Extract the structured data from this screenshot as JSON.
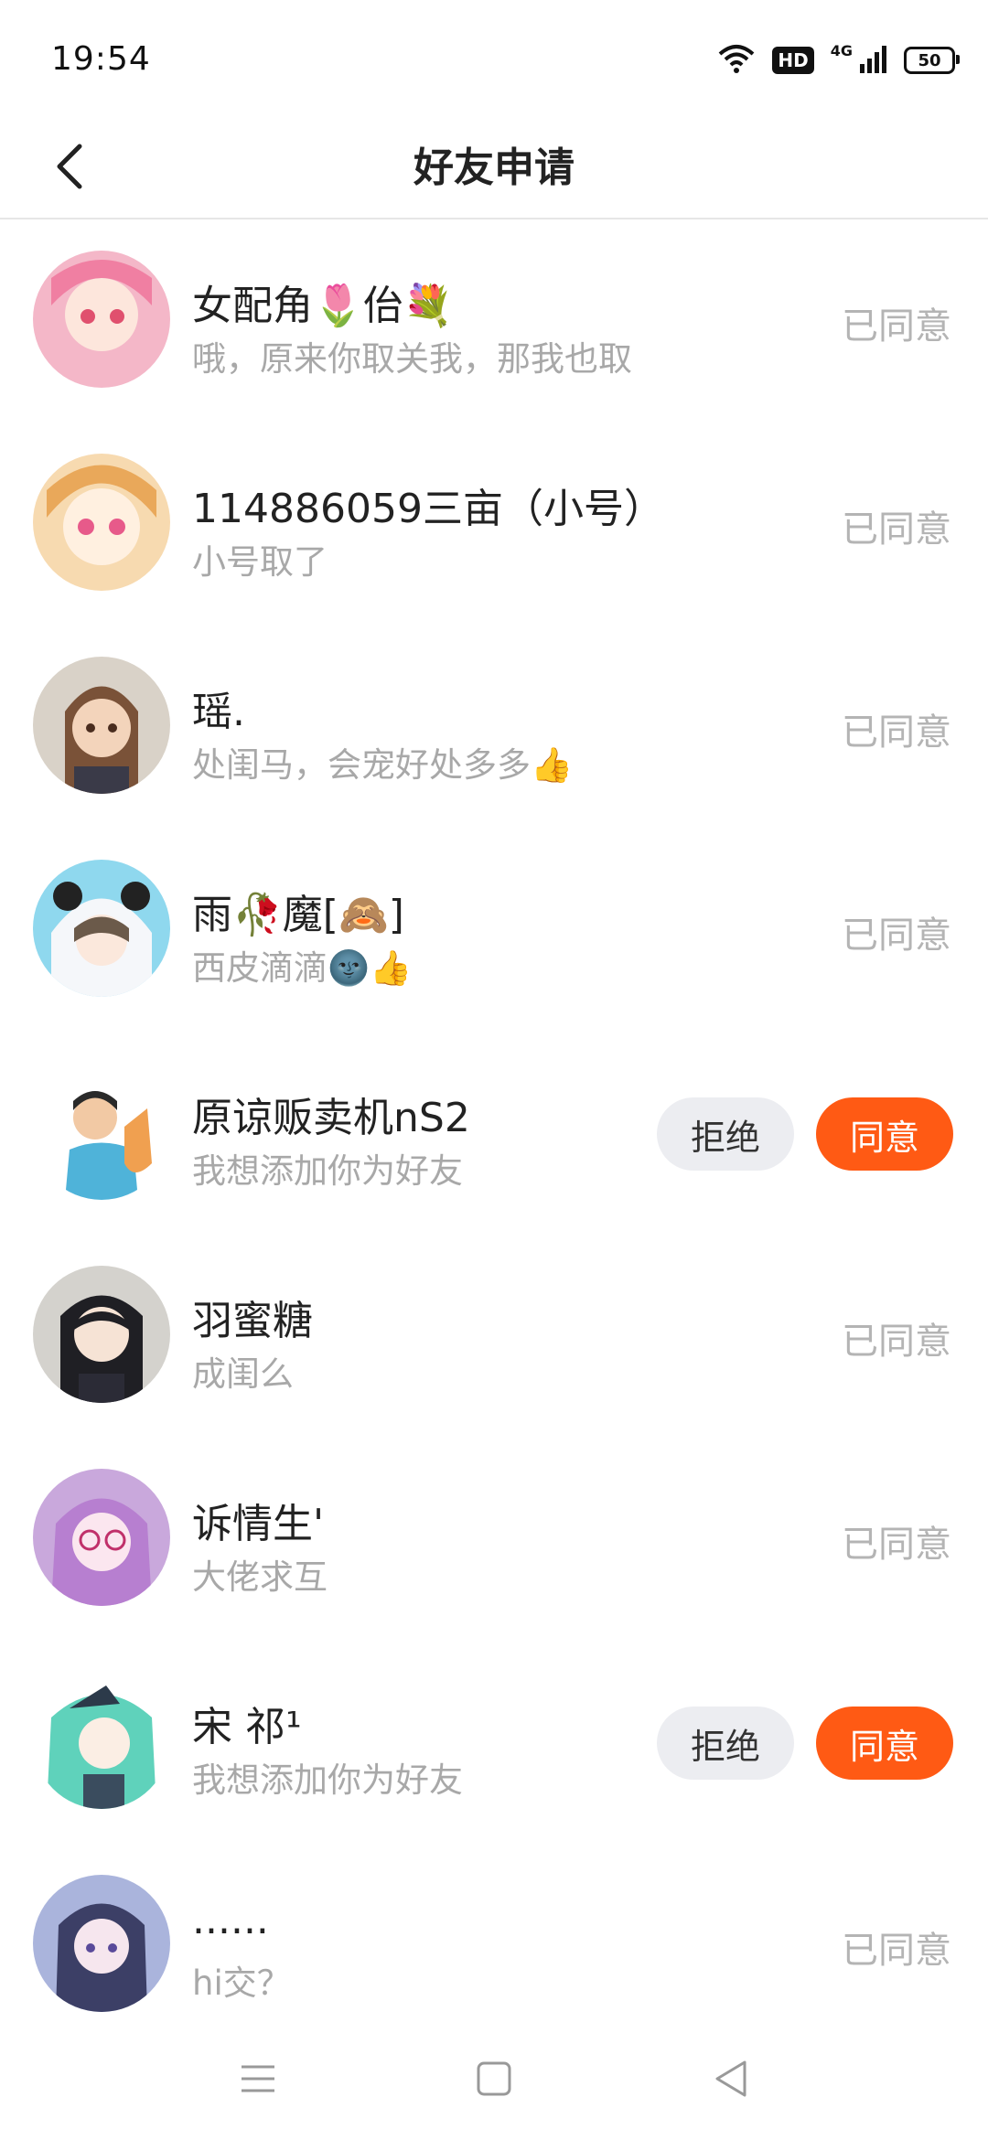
{
  "status_bar": {
    "time": "19:54",
    "hd": "HD",
    "network": "4G",
    "battery": "50"
  },
  "header": {
    "title": "好友申请",
    "back_icon": "chevron-left-icon"
  },
  "requests": [
    {
      "name": "女配角🌷佁💐",
      "message": "哦，原来你取关我，那我也取",
      "status": "已同意",
      "avatar_color": "#f4b7c8"
    },
    {
      "name": "114886059三亩（小号）",
      "message": "小号取了",
      "status": "已同意",
      "avatar_color": "#f3c98f"
    },
    {
      "name": "瑶.",
      "message": "处闺马，会宠好处多多👍",
      "status": "已同意",
      "avatar_color": "#cdbfae"
    },
    {
      "name": "雨🥀魔[🙈]",
      "message": "西皮滴滴🌚👍",
      "status": "已同意",
      "avatar_color": "#7fcfe6"
    },
    {
      "name": "原谅贩卖机nS2",
      "message": "我想添加你为好友",
      "reject_label": "拒绝",
      "agree_label": "同意",
      "avatar_color": "#6bb8d8"
    },
    {
      "name": "羽蜜糖",
      "message": "成闺么",
      "status": "已同意",
      "avatar_color": "#b9b6b0"
    },
    {
      "name": "诉情生'",
      "message": "大佬求互",
      "status": "已同意",
      "avatar_color": "#c7a3d8"
    },
    {
      "name": "宋  祁¹",
      "message": "我想添加你为好友",
      "reject_label": "拒绝",
      "agree_label": "同意",
      "avatar_color": "#6fd4c2"
    },
    {
      "name": "......",
      "message": "hi交？",
      "status": "已同意",
      "avatar_color": "#9aa6d4"
    }
  ],
  "colors": {
    "accent": "#ff5a14",
    "reject_bg": "#ecedf1",
    "muted_text": "#a8a8a8"
  },
  "nav": {
    "menu_icon": "menu-icon",
    "home_icon": "square-home-icon",
    "back_icon": "triangle-back-icon"
  }
}
